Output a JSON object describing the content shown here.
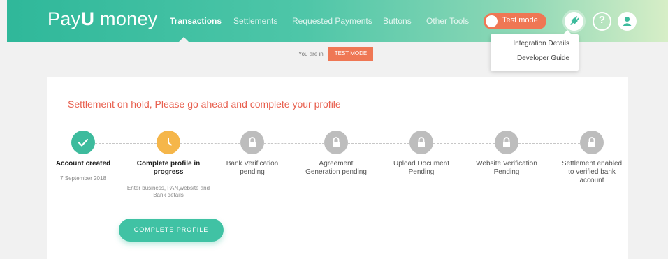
{
  "header": {
    "logo_prefix": "Pay",
    "logo_u": "U",
    "logo_suffix": " money",
    "nav": [
      "Transactions",
      "Settlements",
      "Requested Payments",
      "Buttons",
      "Other Tools"
    ],
    "active_nav": "Transactions",
    "test_mode_toggle": "Test mode",
    "help_glyph": "?"
  },
  "dropdown": {
    "items": [
      "Integration Details",
      "Developer Guide"
    ]
  },
  "mode_banner": {
    "prefix": "You are in",
    "badge": "TEST MODE"
  },
  "notice": "Settlement on hold, Please go ahead and complete your profile",
  "steps": [
    {
      "title": "Account created",
      "subtitle": "7 September 2018",
      "status": "done"
    },
    {
      "title": "Complete profile in progress",
      "subtitle": "Enter business, PAN,website and Bank details",
      "status": "in-progress"
    },
    {
      "title": "Bank Verification pending",
      "status": "locked"
    },
    {
      "title": "Agreement Generation pending",
      "status": "locked"
    },
    {
      "title": "Upload Document Pending",
      "status": "locked"
    },
    {
      "title": "Website Verification Pending",
      "status": "locked"
    },
    {
      "title": "Settlement enabled to verified bank account",
      "status": "locked"
    }
  ],
  "cta_label": "COMPLETE PROFILE",
  "colors": {
    "accent": "#3dbb9d",
    "warning": "#f5b64a",
    "alert": "#e8604f",
    "test_mode": "#ef7754",
    "locked": "#bdbdbd"
  },
  "icons": {
    "plug": "plug-icon",
    "help": "help-icon",
    "user": "user-icon",
    "done": "check-icon",
    "in_progress": "clock-icon",
    "locked": "lock-icon"
  }
}
